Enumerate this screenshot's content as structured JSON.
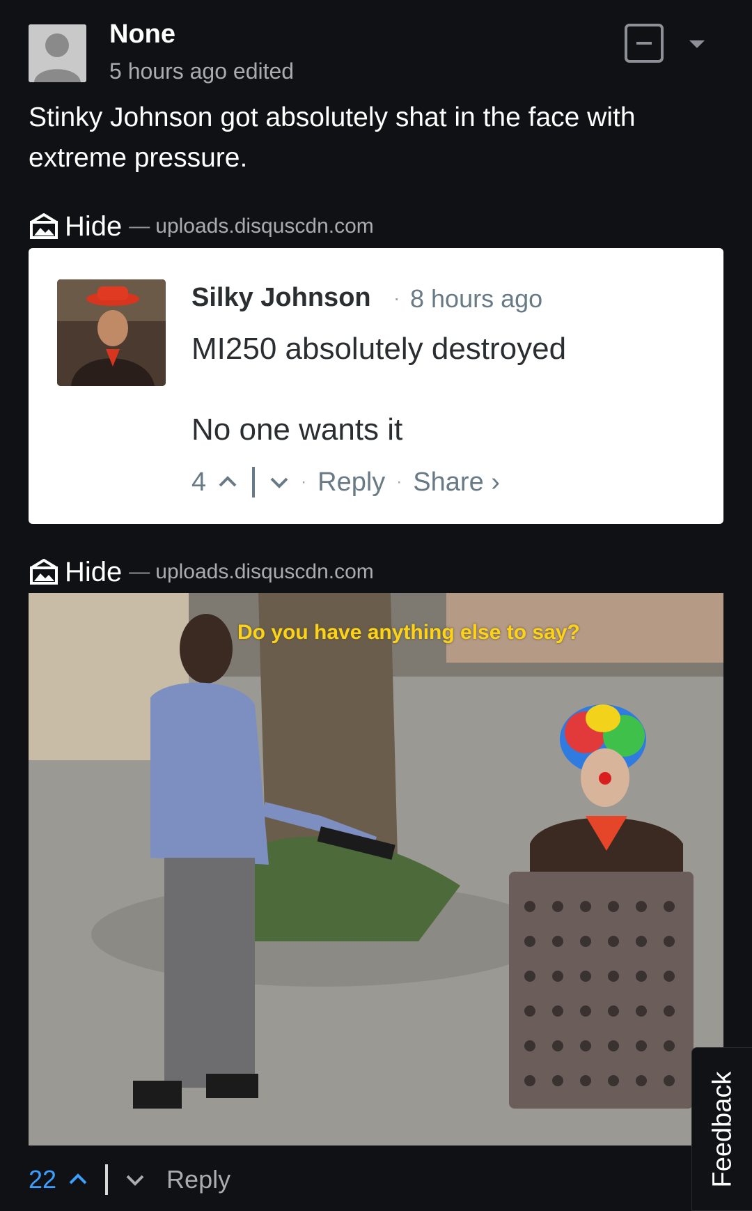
{
  "comment": {
    "username": "None",
    "meta": "5 hours ago edited",
    "text": "Stinky Johnson got absolutely shat in the face with extreme pressure.",
    "votes": "22",
    "reply_label": "Reply"
  },
  "attachments": [
    {
      "hide_label": "Hide",
      "separator": "—",
      "domain": "uploads.disquscdn.com"
    },
    {
      "hide_label": "Hide",
      "separator": "—",
      "domain": "uploads.disquscdn.com"
    }
  ],
  "embedded_comment": {
    "author": "Silky Johnson",
    "dot": "·",
    "time": "8 hours ago",
    "line1": "MI250 absolutely destroyed",
    "line2": "No one wants it",
    "votes": "4",
    "reply_label": "Reply",
    "share_label": "Share ›"
  },
  "meme": {
    "caption": "Do you have anything else to say?"
  },
  "feedback_label": "Feedback",
  "colors": {
    "background": "#101114",
    "accent_vote": "#3a9fff",
    "muted": "#a9acb1"
  },
  "icons": [
    "avatar-placeholder-icon",
    "collapse-icon",
    "caret-down-icon",
    "hide-image-icon",
    "chevron-up-icon",
    "chevron-down-icon"
  ]
}
